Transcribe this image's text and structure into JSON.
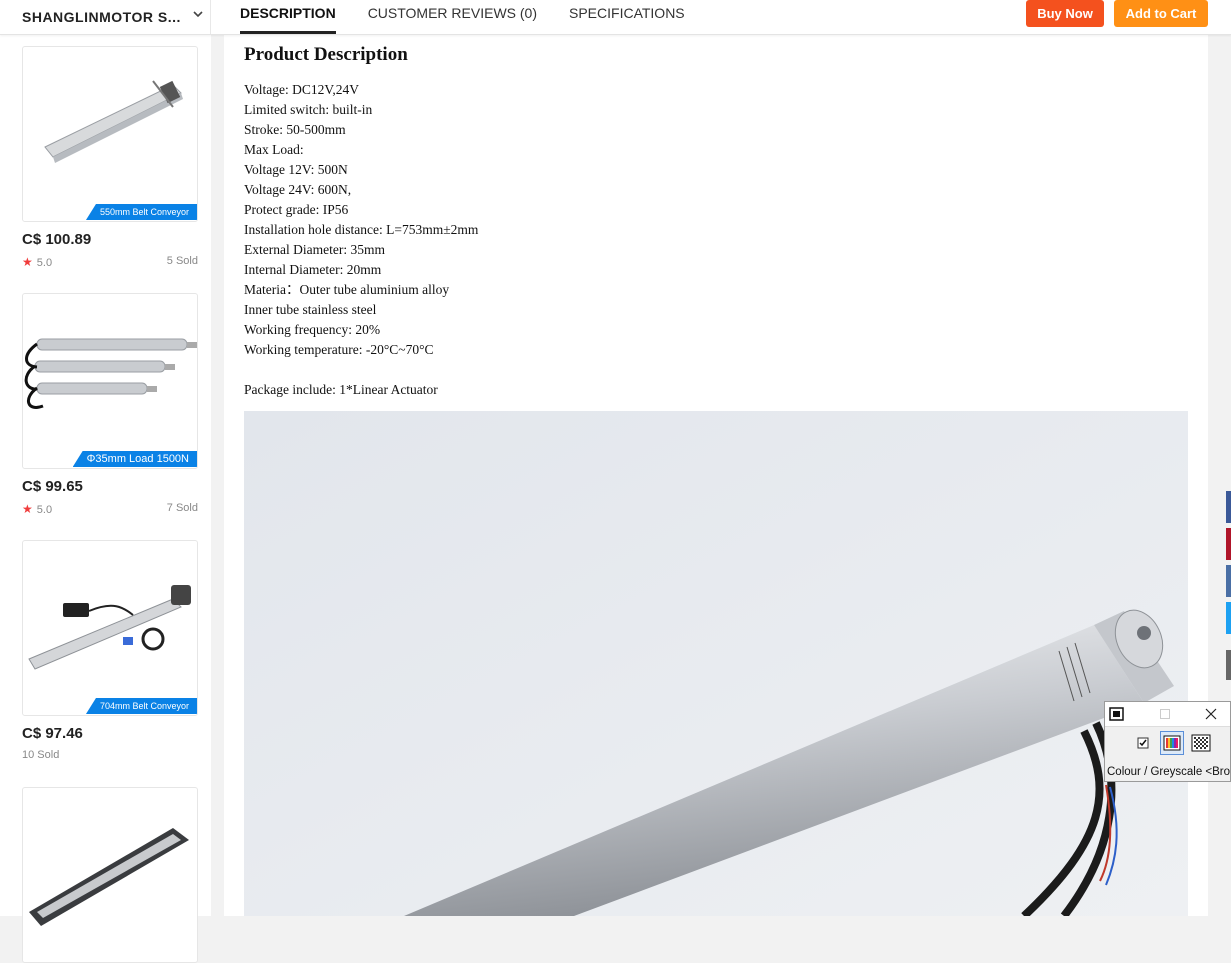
{
  "header": {
    "store_name": "SHANGLINMOTOR S...",
    "tabs": [
      {
        "label": "DESCRIPTION",
        "active": true
      },
      {
        "label": "CUSTOMER REVIEWS (0)",
        "active": false
      },
      {
        "label": "SPECIFICATIONS",
        "active": false
      }
    ],
    "buy_now": "Buy Now",
    "add_to_cart": "Add to Cart"
  },
  "sidebar": {
    "products": [
      {
        "tag": "550mm Belt Conveyor",
        "price": "C$ 100.89",
        "rating": "5.0",
        "sold": "5 Sold"
      },
      {
        "tag": "Φ35mm Load 1500N",
        "price": "C$ 99.65",
        "rating": "5.0",
        "sold": "7 Sold"
      },
      {
        "tag": "704mm Belt Conveyor",
        "price": "C$ 97.46",
        "rating": "",
        "sold": "10 Sold"
      },
      {
        "tag": "",
        "price": "",
        "rating": "",
        "sold": ""
      }
    ]
  },
  "main": {
    "heading": "Product Description",
    "lines": [
      "Voltage: DC12V,24V",
      "Limited switch: built-in",
      "Stroke: 50-500mm",
      "Max Load:",
      "Voltage 12V: 500N",
      "Voltage 24V: 600N,",
      "Protect grade: IP56",
      "Installation hole distance: L=753mm±2mm",
      "External Diameter: 35mm",
      "Internal Diameter: 20mm",
      "Materia：Outer tube aluminium alloy",
      "Inner tube stainless steel",
      "Working frequency: 20%",
      "Working temperature: -20°C~70°C"
    ],
    "package": "Package include: 1*Linear Actuator"
  },
  "tool_window": {
    "status": "Colour / Greyscale <Bro"
  },
  "colors": {
    "buy_now": "#f4511e",
    "add_to_cart": "#ff9015",
    "tag_blue": "#0a82e6",
    "star": "#f03c3c"
  }
}
